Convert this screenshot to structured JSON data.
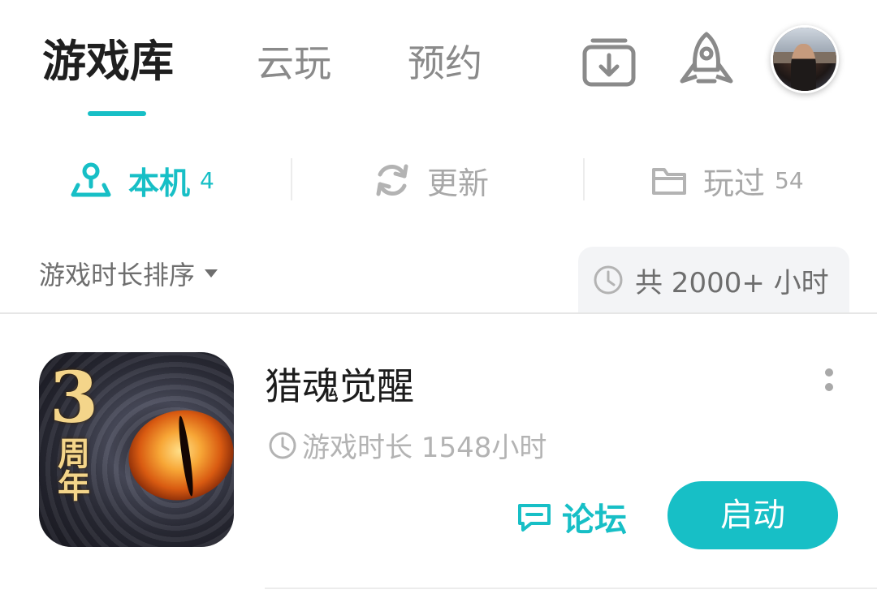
{
  "header": {
    "tabs": [
      {
        "label": "游戏库",
        "active": true
      },
      {
        "label": "云玩",
        "active": false
      },
      {
        "label": "预约",
        "active": false
      }
    ],
    "icons": [
      "download-icon",
      "rocket-icon"
    ],
    "accent_color": "#17bfc6"
  },
  "filters": [
    {
      "label": "本机",
      "count": "4",
      "icon": "local-device-icon",
      "active": true
    },
    {
      "label": "更新",
      "count": "",
      "icon": "refresh-icon",
      "active": false
    },
    {
      "label": "玩过",
      "count": "54",
      "icon": "folder-icon",
      "active": false
    }
  ],
  "sort": {
    "label": "游戏时长排序",
    "total_label": "共 2000+ 小时"
  },
  "games": [
    {
      "title": "猎魂觉醒",
      "icon_badge_number": "3",
      "icon_badge_text": "周年",
      "playtime": "游戏时长 1548小时",
      "forum_label": "论坛",
      "launch_label": "启动"
    }
  ]
}
